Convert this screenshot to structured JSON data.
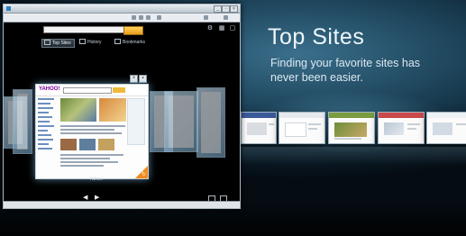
{
  "hero": {
    "title": "Top Sites",
    "tagline": "Finding your favorite sites has never been easier."
  },
  "browser": {
    "tabs": [
      {
        "label": "Top Sites",
        "active": true
      },
      {
        "label": "History",
        "active": false
      },
      {
        "label": "Bookmarks",
        "active": false
      }
    ],
    "featured_thumbnail": {
      "label": "Yahoo!",
      "site_logo": "YAHOO!"
    }
  },
  "colors": {
    "accent": "#f08a1c",
    "background": "#1c4258"
  }
}
